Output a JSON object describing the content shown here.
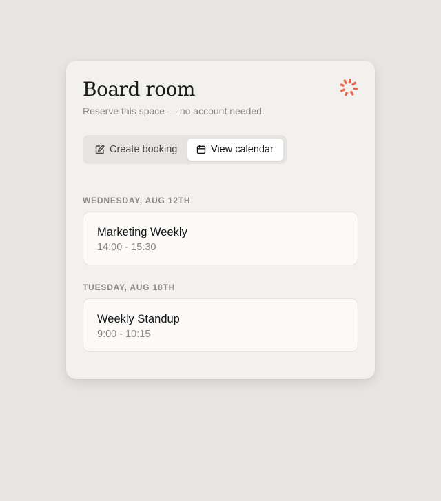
{
  "page": {
    "title": "Board room",
    "subtitle": "Reserve this space — no account needed."
  },
  "toggle": {
    "create_label": "Create booking",
    "view_label": "View calendar",
    "active": "view"
  },
  "days": [
    {
      "label": "WEDNESDAY, AUG 12TH",
      "events": [
        {
          "title": "Marketing Weekly",
          "time": "14:00 - 15:30"
        }
      ]
    },
    {
      "label": "TUESDAY, AUG 18TH",
      "events": [
        {
          "title": "Weekly Standup",
          "time": "9:00 - 10:15"
        }
      ]
    }
  ],
  "icons": {
    "logo": "spinner-burst-icon",
    "create": "edit-icon",
    "view": "calendar-icon"
  },
  "colors": {
    "background": "#e8e6e2",
    "card": "#f2f1ee",
    "accent": "#e8654f"
  }
}
